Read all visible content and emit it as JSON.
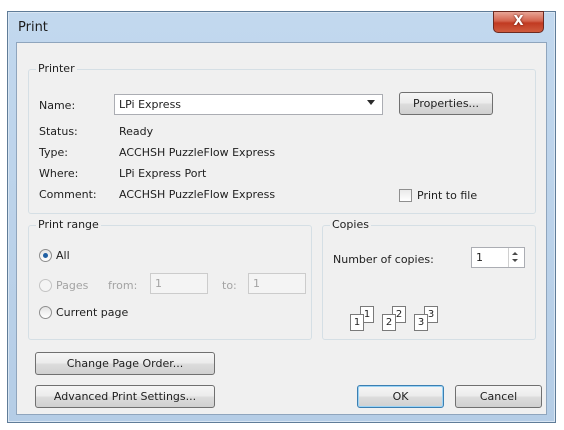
{
  "window": {
    "title": "Print",
    "close_glyph": "X"
  },
  "printer": {
    "group_label": "Printer",
    "name_label": "Name:",
    "name_value": "LPi Express",
    "properties_button": "Properties...",
    "status_label": "Status:",
    "status_value": "Ready",
    "type_label": "Type:",
    "type_value": "ACCHSH PuzzleFlow Express",
    "where_label": "Where:",
    "where_value": "LPi Express Port",
    "comment_label": "Comment:",
    "comment_value": "ACCHSH PuzzleFlow Express",
    "print_to_file_label": "Print to file"
  },
  "print_range": {
    "group_label": "Print range",
    "all_label": "All",
    "pages_label": "Pages",
    "from_label": "from:",
    "from_value": "1",
    "to_label": "to:",
    "to_value": "1",
    "current_page_label": "Current page"
  },
  "copies": {
    "group_label": "Copies",
    "number_label": "Number of copies:",
    "number_value": "1",
    "collate_pages": [
      "1",
      "1",
      "2",
      "2",
      "3",
      "3"
    ]
  },
  "buttons": {
    "change_page_order": "Change Page Order...",
    "advanced_settings": "Advanced Print Settings...",
    "ok": "OK",
    "cancel": "Cancel"
  },
  "colors": {
    "title_bar": "#b5cde6",
    "close_button": "#c13a22",
    "dialog_bg": "#f0f0f0",
    "radio_selected": "#1f5fa3"
  },
  "icons": [
    "close-icon",
    "dropdown-arrow-icon",
    "spinner-up-icon",
    "spinner-down-icon",
    "collate-pages-icon"
  ]
}
